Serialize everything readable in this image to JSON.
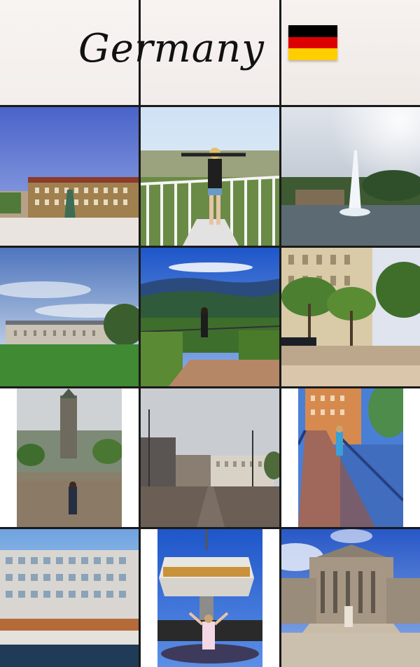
{
  "header": {
    "title": "Germany",
    "flag_icon": "germany-flag-icon",
    "flag_colors": [
      "#000000",
      "#dd0000",
      "#ffce00"
    ]
  },
  "tiles": [
    {
      "name": "tile-header-left",
      "scene": "white-gradient"
    },
    {
      "name": "tile-header-center",
      "scene": "white-gradient"
    },
    {
      "name": "tile-header-right",
      "scene": "white-gradient"
    },
    {
      "name": "tile-town-square-statue",
      "scene": "plaza"
    },
    {
      "name": "tile-balcony-viewpoint",
      "scene": "balcony"
    },
    {
      "name": "tile-lake-fountain",
      "scene": "fountain"
    },
    {
      "name": "tile-palace-lawn",
      "scene": "palace"
    },
    {
      "name": "tile-forest-hills-view",
      "scene": "hills"
    },
    {
      "name": "tile-tree-lined-street",
      "scene": "street"
    },
    {
      "name": "tile-city-hall-tower",
      "scene": "cityhall"
    },
    {
      "name": "tile-rainy-plaza",
      "scene": "rainy-plaza"
    },
    {
      "name": "tile-bridge-walkway",
      "scene": "bridge"
    },
    {
      "name": "tile-riverside-hotel",
      "scene": "riverside"
    },
    {
      "name": "tile-world-clock",
      "scene": "worldclock"
    },
    {
      "name": "tile-concert-hall",
      "scene": "concert-hall"
    }
  ]
}
